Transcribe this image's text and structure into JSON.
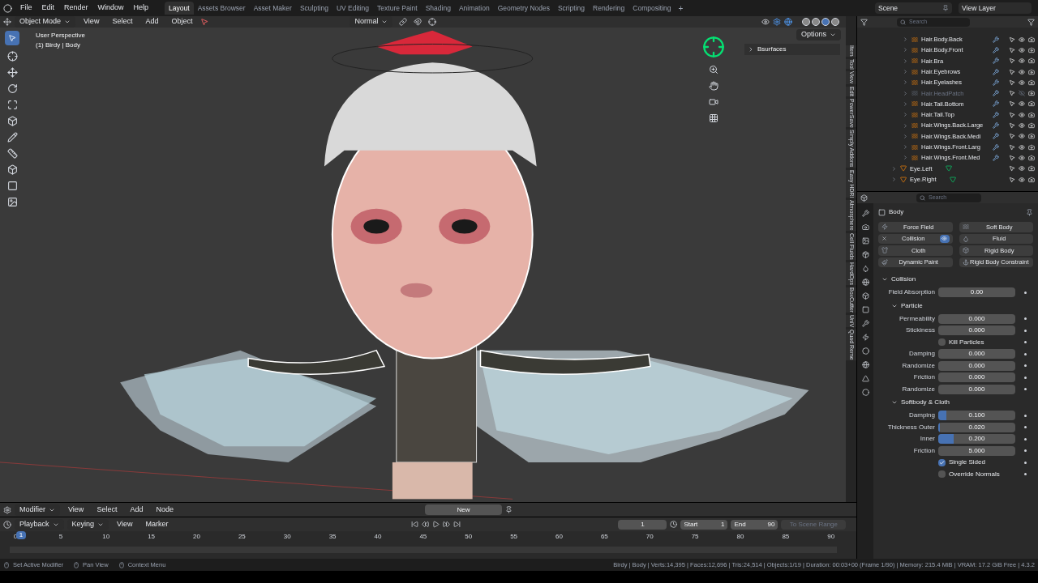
{
  "menu": [
    "File",
    "Edit",
    "Render",
    "Window",
    "Help"
  ],
  "workspaces": [
    {
      "label": "Layout",
      "selected": true
    },
    {
      "label": "Assets Browser",
      "selected": false
    },
    {
      "label": "Asset Maker",
      "selected": false
    },
    {
      "label": "Sculpting",
      "selected": false
    },
    {
      "label": "UV Editing",
      "selected": false
    },
    {
      "label": "Texture Paint",
      "selected": false
    },
    {
      "label": "Shading",
      "selected": false
    },
    {
      "label": "Animation",
      "selected": false
    },
    {
      "label": "Geometry Nodes",
      "selected": false
    },
    {
      "label": "Scripting",
      "selected": false
    },
    {
      "label": "Rendering",
      "selected": false
    },
    {
      "label": "Compositing",
      "selected": false
    }
  ],
  "add_workspace": "+",
  "scene": "Scene",
  "view_layer": "View Layer",
  "viewport": {
    "mode": "Object Mode",
    "menus": [
      "View",
      "Select",
      "Add",
      "Object"
    ],
    "orientation": "Normal",
    "options": "Options",
    "view_name": "User Perspective",
    "object_path": "(1) Birdy | Body",
    "panel": "Bsurfaces",
    "shading": [
      {
        "selected": false
      },
      {
        "selected": false
      },
      {
        "selected": true
      },
      {
        "selected": false
      }
    ]
  },
  "sidebar_tabs": [
    "Item",
    "Tool",
    "View",
    "Edit",
    "PowerSave",
    "Simply Addons",
    "Easy HDRI",
    "Atmosphere",
    "Cell Fluids",
    "HardOps",
    "BoxCutter",
    "UniV",
    "Quad Reme"
  ],
  "outliner": {
    "search": {
      "placeholder": "Search"
    },
    "hair_objects": [
      {
        "name": "Hair.Body.Back",
        "visible": true
      },
      {
        "name": "Hair.Body.Front",
        "visible": true
      },
      {
        "name": "Hair.Bra",
        "visible": true
      },
      {
        "name": "Hair.Eyebrows",
        "visible": true
      },
      {
        "name": "Hair.Eyelashes",
        "visible": true
      },
      {
        "name": "Hair.HeadPatch",
        "visible": false
      },
      {
        "name": "Hair.Tail.Bottom",
        "visible": true
      },
      {
        "name": "Hair.Tail.Top",
        "visible": true
      },
      {
        "name": "Hair.Wings.Back.Large",
        "visible": true
      },
      {
        "name": "Hair.Wings.Back.Medi",
        "visible": true
      },
      {
        "name": "Hair.Wings.Front.Larg",
        "visible": true
      },
      {
        "name": "Hair.Wings.Front.Med",
        "visible": true
      }
    ],
    "objects": [
      {
        "name": "Eye.Left",
        "visible": true
      },
      {
        "name": "Eye.Right",
        "visible": true
      }
    ]
  },
  "properties": {
    "search": {
      "placeholder": "Search"
    },
    "object": "Body",
    "physics": [
      {
        "label": "Force Field",
        "enabled": false
      },
      {
        "label": "Soft Body",
        "enabled": false
      },
      {
        "label": "Collision",
        "enabled": true
      },
      {
        "label": "Fluid",
        "enabled": false
      },
      {
        "label": "Cloth",
        "enabled": false
      },
      {
        "label": "Rigid Body",
        "enabled": false
      },
      {
        "label": "Dynamic Paint",
        "enabled": false
      },
      {
        "label": "Rigid Body Constraint",
        "enabled": false
      }
    ],
    "collision": {
      "title": "Collision",
      "expanded": true,
      "rows": [
        {
          "kind": "field",
          "label": "Field Absorption",
          "value": "0.00"
        }
      ]
    },
    "particle": {
      "title": "Particle",
      "expanded": true,
      "rows": [
        {
          "kind": "field",
          "label": "Permeability",
          "value": "0.000"
        },
        {
          "kind": "field",
          "label": "Stickiness",
          "value": "0.000"
        },
        {
          "kind": "checkbox",
          "label": "Kill Particles",
          "checked": false
        },
        {
          "kind": "field",
          "label": "Damping",
          "value": "0.000"
        },
        {
          "kind": "field",
          "label": "Randomize",
          "value": "0.000"
        },
        {
          "kind": "field",
          "label": "Friction",
          "value": "0.000"
        },
        {
          "kind": "field",
          "label": "Randomize",
          "value": "0.000"
        }
      ]
    },
    "softbody": {
      "title": "Softbody & Cloth",
      "expanded": true,
      "rows": [
        {
          "kind": "slider",
          "label": "Damping",
          "value": "0.100",
          "level": 0.1
        },
        {
          "kind": "slider",
          "label": "Thickness Outer",
          "value": "0.020",
          "level": 0.02
        },
        {
          "kind": "slider",
          "label": "Inner",
          "value": "0.200",
          "level": 0.2
        },
        {
          "kind": "field",
          "label": "Friction",
          "value": "5.000"
        },
        {
          "kind": "checkbox",
          "label": "Single Sided",
          "checked": true
        },
        {
          "kind": "checkbox",
          "label": "Override Normals",
          "checked": false
        }
      ]
    }
  },
  "node_editor": {
    "menus": [
      "Modifier",
      "View",
      "Select",
      "Add",
      "Node"
    ],
    "new_button": "New"
  },
  "timeline": {
    "menus": [
      "Playback",
      "Keying",
      "View",
      "Marker"
    ],
    "current_frame": "1",
    "start_label": "Start",
    "start": "1",
    "end_label": "End",
    "end": "90",
    "range_button": "To Scene Range",
    "ticks": [
      "0",
      "5",
      "10",
      "15",
      "20",
      "25",
      "30",
      "35",
      "40",
      "45",
      "50",
      "55",
      "60",
      "65",
      "70",
      "75",
      "80",
      "85",
      "90"
    ],
    "playhead": "1"
  },
  "status_bar": {
    "hints": [
      "Set Active Modifier",
      "Pan View",
      "Context Menu"
    ],
    "stats": "Birdy | Body | Verts:14,395 | Faces:12,696 | Tris:24,514 | Objects:1/19 | Duration: 00:03+00 (Frame 1/90) | Memory: 215.4 MiB | VRAM: 17.2 GiB Free | 4.3.2"
  }
}
